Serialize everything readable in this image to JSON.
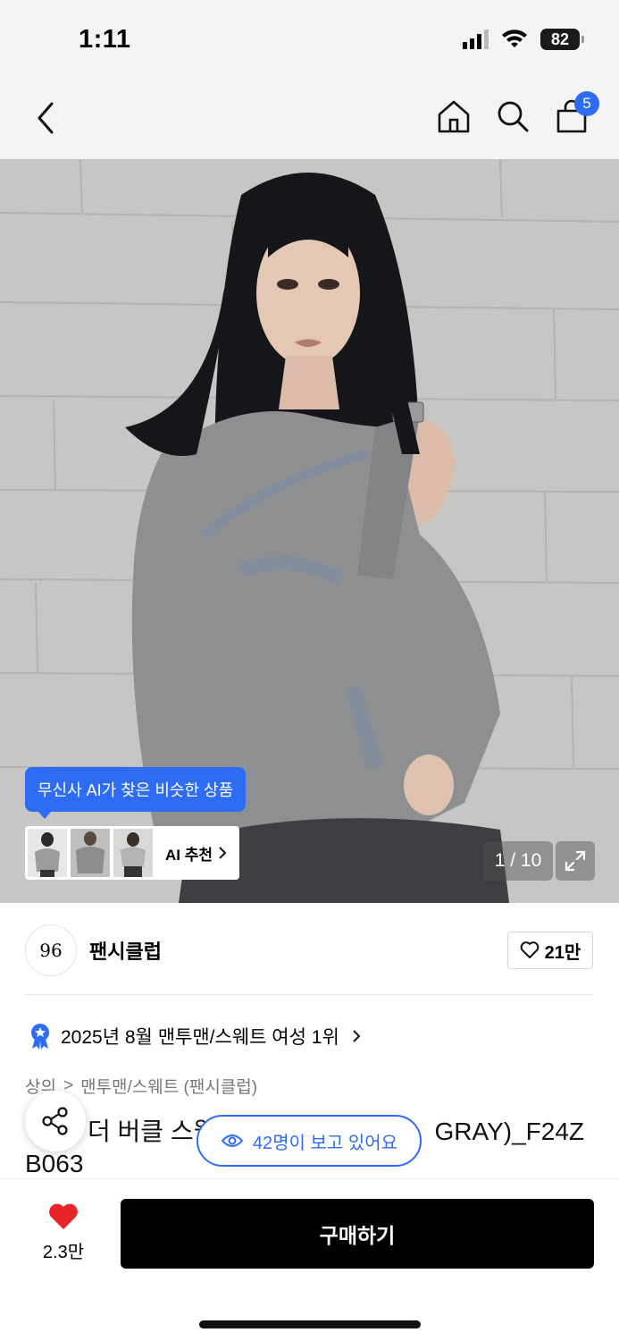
{
  "status_bar": {
    "time": "1:11",
    "battery": "82"
  },
  "nav": {
    "cart_count": "5"
  },
  "hero": {
    "ai_tooltip": "무신사 AI가 찾은 비슷한 상품",
    "ai_recommend_label": "AI 추천",
    "page_indicator": "1 / 10"
  },
  "brand": {
    "logo_text": "96",
    "name": "팬시클럽",
    "likes": "21만"
  },
  "ranking": {
    "text": "2025년 8월 맨투맨/스웨트 여성 1위"
  },
  "breadcrumb": {
    "level1": "상의",
    "separator": ">",
    "level2": "맨투맨/스웨트 (팬시클럽)"
  },
  "product": {
    "title_line1": "더 버클 스웻",
    "title_line1_end": "GRAY)_F24Z",
    "title_line2": "B063"
  },
  "viewers": {
    "text": "42명이 보고 있어요"
  },
  "bottom": {
    "wish_count": "2.3만",
    "buy_label": "구매하기"
  },
  "colors": {
    "accent": "#2f6cf6",
    "heart": "#e8232a",
    "buy_button": "#000000"
  },
  "icons": [
    "back-icon",
    "home-icon",
    "search-icon",
    "cart-icon",
    "expand-icon",
    "heart-outline-icon",
    "ranking-badge-icon",
    "share-icon",
    "eye-icon",
    "heart-filled-icon"
  ]
}
